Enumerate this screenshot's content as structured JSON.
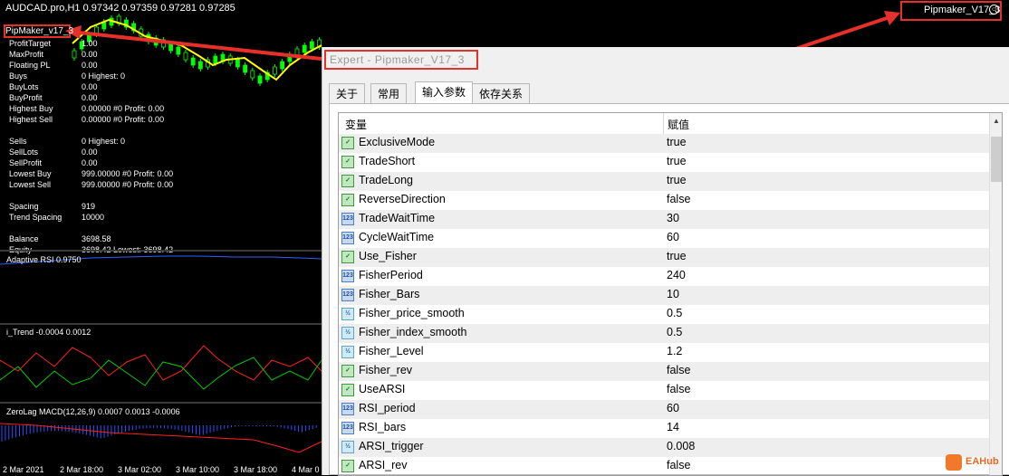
{
  "chart": {
    "title": "AUDCAD.pro,H1  0.97342 0.97359 0.97281 0.97285",
    "ea_name": "Pipmaker_V17_3",
    "ea_label": "PipMaker_v17_3",
    "stats": [
      {
        "key": "ProfitTarget",
        "value": "1.00"
      },
      {
        "key": "MaxProfit",
        "value": "0.00"
      },
      {
        "key": "Floating PL",
        "value": "0.00"
      },
      {
        "key": "Buys",
        "value": "0  Highest: 0"
      },
      {
        "key": "BuyLots",
        "value": "0.00"
      },
      {
        "key": "BuyProfit",
        "value": "0.00"
      },
      {
        "key": "Highest Buy",
        "value": "0.00000 #0  Profit: 0.00"
      },
      {
        "key": "Highest Sell",
        "value": "0.00000 #0  Profit: 0.00"
      },
      {
        "key": "",
        "value": ""
      },
      {
        "key": "Sells",
        "value": "0  Highest: 0"
      },
      {
        "key": "SellLots",
        "value": "0.00"
      },
      {
        "key": "SellProfit",
        "value": "0.00"
      },
      {
        "key": "Lowest Buy",
        "value": "999.00000 #0  Profit: 0.00"
      },
      {
        "key": "Lowest Sell",
        "value": "999.00000 #0  Profit: 0.00"
      },
      {
        "key": "",
        "value": ""
      },
      {
        "key": "Spacing",
        "value": "919"
      },
      {
        "key": "Trend Spacing",
        "value": "10000"
      },
      {
        "key": "",
        "value": ""
      },
      {
        "key": "Balance",
        "value": "3698.58"
      },
      {
        "key": "Equity",
        "value": "3698.42  Lowest: 3698.42"
      }
    ],
    "indicators": {
      "arsi": "Adaptive RSI 0.9750",
      "itrend": "i_Trend -0.0004 0.0012",
      "macd": "ZeroLag MACD(12,26,9) 0.0007 0.0013 -0.0006"
    },
    "time_labels": [
      "2 Mar 2021",
      "2 Mar 18:00",
      "3 Mar 02:00",
      "3 Mar 10:00",
      "3 Mar 18:00",
      "4 Mar 0"
    ]
  },
  "dialog": {
    "title": "Expert - Pipmaker_V17_3",
    "tabs": [
      "关于",
      "常用",
      "输入参数",
      "依存关系"
    ],
    "active_tab": "输入参数",
    "columns": {
      "variable": "变量",
      "value": "赋值"
    },
    "params": [
      {
        "type": "bool",
        "icon": "boolean-param-icon",
        "name": "ExclusiveMode",
        "value": "true"
      },
      {
        "type": "bool",
        "icon": "boolean-param-icon",
        "name": "TradeShort",
        "value": "true"
      },
      {
        "type": "bool",
        "icon": "boolean-param-icon",
        "name": "TradeLong",
        "value": "true"
      },
      {
        "type": "bool",
        "icon": "boolean-param-icon",
        "name": "ReverseDirection",
        "value": "false"
      },
      {
        "type": "int",
        "icon": "integer-param-icon",
        "name": "TradeWaitTime",
        "value": "30"
      },
      {
        "type": "int",
        "icon": "integer-param-icon",
        "name": "CycleWaitTime",
        "value": "60"
      },
      {
        "type": "bool",
        "icon": "boolean-param-icon",
        "name": "Use_Fisher",
        "value": "true"
      },
      {
        "type": "int",
        "icon": "integer-param-icon",
        "name": "FisherPeriod",
        "value": "240"
      },
      {
        "type": "int",
        "icon": "integer-param-icon",
        "name": "Fisher_Bars",
        "value": "10"
      },
      {
        "type": "dbl",
        "icon": "double-param-icon",
        "name": "Fisher_price_smooth",
        "value": "0.5"
      },
      {
        "type": "dbl",
        "icon": "double-param-icon",
        "name": "Fisher_index_smooth",
        "value": "0.5"
      },
      {
        "type": "dbl",
        "icon": "double-param-icon",
        "name": "Fisher_Level",
        "value": "1.2"
      },
      {
        "type": "bool",
        "icon": "boolean-param-icon",
        "name": "Fisher_rev",
        "value": "false"
      },
      {
        "type": "bool",
        "icon": "boolean-param-icon",
        "name": "UseARSI",
        "value": "false"
      },
      {
        "type": "int",
        "icon": "integer-param-icon",
        "name": "RSI_period",
        "value": "60"
      },
      {
        "type": "int",
        "icon": "integer-param-icon",
        "name": "RSI_bars",
        "value": "14"
      },
      {
        "type": "dbl",
        "icon": "double-param-icon",
        "name": "ARSI_trigger",
        "value": "0.008"
      },
      {
        "type": "bool",
        "icon": "boolean-param-icon",
        "name": "ARSI_rev",
        "value": "false"
      }
    ]
  },
  "watermark": {
    "text": "EAHub"
  },
  "colors": {
    "annotation": "#e8302a",
    "bull_candle": "#00ff00",
    "ma_line": "#ffff00",
    "trend_up": "#00cc00",
    "trend_down": "#ff2020",
    "macd_hist": "#3050ff"
  }
}
